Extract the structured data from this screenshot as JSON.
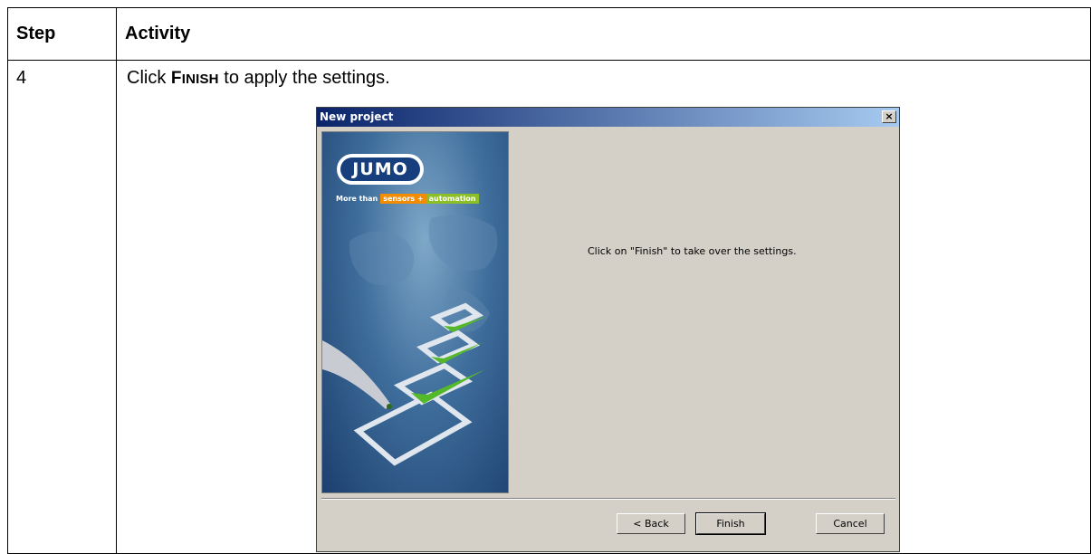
{
  "table": {
    "headers": [
      "Step",
      "Activity"
    ],
    "row": {
      "step": "4",
      "activity_prefix": "Click ",
      "activity_keyword_first": "F",
      "activity_keyword_rest": "INISH",
      "activity_suffix": " to apply the settings."
    }
  },
  "dialog": {
    "title": "New project",
    "close_glyph": "×",
    "logo_text": "JUMO",
    "tagline_more": "More than",
    "tagline_sensors": "sensors",
    "tagline_plus": "+",
    "tagline_automation": "automation",
    "message": "Click on \"Finish\" to take over the settings.",
    "buttons": {
      "back": "< Back",
      "finish": "Finish",
      "cancel": "Cancel"
    }
  }
}
